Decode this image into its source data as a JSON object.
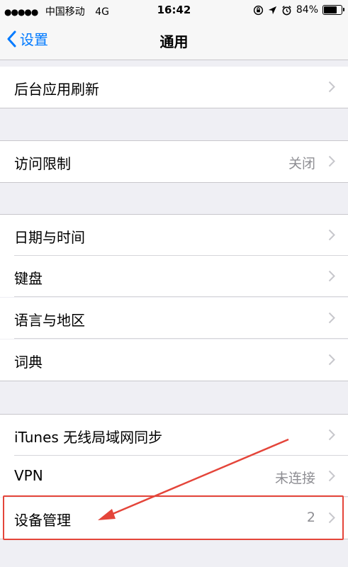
{
  "status_bar": {
    "signal": "●●●●●",
    "carrier": "中国移动",
    "network": "4G",
    "time": "16:42",
    "battery": "84%",
    "battery_level": 0.84
  },
  "nav": {
    "back_label": "设置",
    "title": "通用"
  },
  "rows": [
    {
      "label": "后台应用刷新",
      "value": ""
    },
    {
      "label": "访问限制",
      "value": "关闭"
    },
    {
      "label": "日期与时间",
      "value": ""
    },
    {
      "label": "键盘",
      "value": ""
    },
    {
      "label": "语言与地区",
      "value": ""
    },
    {
      "label": "词典",
      "value": ""
    },
    {
      "label": "iTunes 无线局域网同步",
      "value": ""
    },
    {
      "label": "VPN",
      "value": "未连接"
    },
    {
      "label": "设备管理",
      "value": "2"
    }
  ],
  "colors": {
    "accent": "#007aff",
    "highlight": "#e4453a"
  }
}
